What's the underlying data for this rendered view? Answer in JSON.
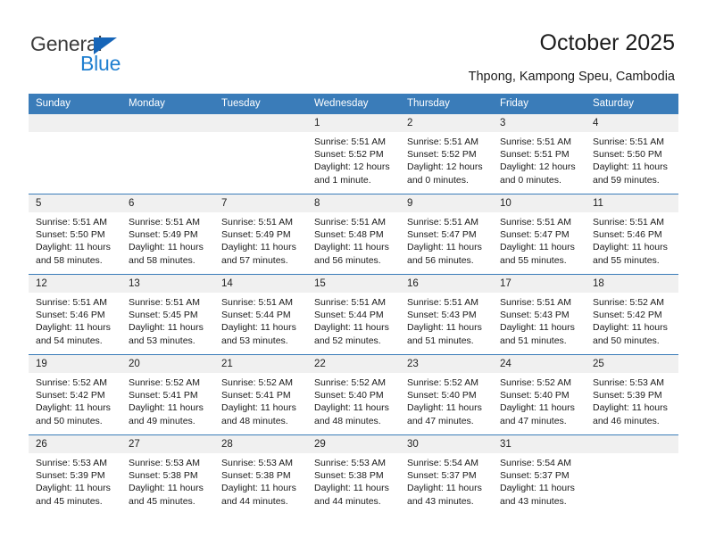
{
  "brand": {
    "name_part1": "General",
    "name_part2": "Blue",
    "accent_color": "#1f7fd0",
    "triangle_color": "#1665b8"
  },
  "header": {
    "title": "October 2025",
    "subtitle": "Thpong, Kampong Speu, Cambodia"
  },
  "calendar": {
    "header_color": "#3a7cb9",
    "weekdays": [
      "Sunday",
      "Monday",
      "Tuesday",
      "Wednesday",
      "Thursday",
      "Friday",
      "Saturday"
    ],
    "weeks": [
      [
        {
          "day": "",
          "blank": true,
          "sunrise": "",
          "sunset": "",
          "daylight1": "",
          "daylight2": ""
        },
        {
          "day": "",
          "blank": true,
          "sunrise": "",
          "sunset": "",
          "daylight1": "",
          "daylight2": ""
        },
        {
          "day": "",
          "blank": true,
          "sunrise": "",
          "sunset": "",
          "daylight1": "",
          "daylight2": ""
        },
        {
          "day": "1",
          "blank": false,
          "sunrise": "Sunrise: 5:51 AM",
          "sunset": "Sunset: 5:52 PM",
          "daylight1": "Daylight: 12 hours",
          "daylight2": "and 1 minute."
        },
        {
          "day": "2",
          "blank": false,
          "sunrise": "Sunrise: 5:51 AM",
          "sunset": "Sunset: 5:52 PM",
          "daylight1": "Daylight: 12 hours",
          "daylight2": "and 0 minutes."
        },
        {
          "day": "3",
          "blank": false,
          "sunrise": "Sunrise: 5:51 AM",
          "sunset": "Sunset: 5:51 PM",
          "daylight1": "Daylight: 12 hours",
          "daylight2": "and 0 minutes."
        },
        {
          "day": "4",
          "blank": false,
          "sunrise": "Sunrise: 5:51 AM",
          "sunset": "Sunset: 5:50 PM",
          "daylight1": "Daylight: 11 hours",
          "daylight2": "and 59 minutes."
        }
      ],
      [
        {
          "day": "5",
          "blank": false,
          "sunrise": "Sunrise: 5:51 AM",
          "sunset": "Sunset: 5:50 PM",
          "daylight1": "Daylight: 11 hours",
          "daylight2": "and 58 minutes."
        },
        {
          "day": "6",
          "blank": false,
          "sunrise": "Sunrise: 5:51 AM",
          "sunset": "Sunset: 5:49 PM",
          "daylight1": "Daylight: 11 hours",
          "daylight2": "and 58 minutes."
        },
        {
          "day": "7",
          "blank": false,
          "sunrise": "Sunrise: 5:51 AM",
          "sunset": "Sunset: 5:49 PM",
          "daylight1": "Daylight: 11 hours",
          "daylight2": "and 57 minutes."
        },
        {
          "day": "8",
          "blank": false,
          "sunrise": "Sunrise: 5:51 AM",
          "sunset": "Sunset: 5:48 PM",
          "daylight1": "Daylight: 11 hours",
          "daylight2": "and 56 minutes."
        },
        {
          "day": "9",
          "blank": false,
          "sunrise": "Sunrise: 5:51 AM",
          "sunset": "Sunset: 5:47 PM",
          "daylight1": "Daylight: 11 hours",
          "daylight2": "and 56 minutes."
        },
        {
          "day": "10",
          "blank": false,
          "sunrise": "Sunrise: 5:51 AM",
          "sunset": "Sunset: 5:47 PM",
          "daylight1": "Daylight: 11 hours",
          "daylight2": "and 55 minutes."
        },
        {
          "day": "11",
          "blank": false,
          "sunrise": "Sunrise: 5:51 AM",
          "sunset": "Sunset: 5:46 PM",
          "daylight1": "Daylight: 11 hours",
          "daylight2": "and 55 minutes."
        }
      ],
      [
        {
          "day": "12",
          "blank": false,
          "sunrise": "Sunrise: 5:51 AM",
          "sunset": "Sunset: 5:46 PM",
          "daylight1": "Daylight: 11 hours",
          "daylight2": "and 54 minutes."
        },
        {
          "day": "13",
          "blank": false,
          "sunrise": "Sunrise: 5:51 AM",
          "sunset": "Sunset: 5:45 PM",
          "daylight1": "Daylight: 11 hours",
          "daylight2": "and 53 minutes."
        },
        {
          "day": "14",
          "blank": false,
          "sunrise": "Sunrise: 5:51 AM",
          "sunset": "Sunset: 5:44 PM",
          "daylight1": "Daylight: 11 hours",
          "daylight2": "and 53 minutes."
        },
        {
          "day": "15",
          "blank": false,
          "sunrise": "Sunrise: 5:51 AM",
          "sunset": "Sunset: 5:44 PM",
          "daylight1": "Daylight: 11 hours",
          "daylight2": "and 52 minutes."
        },
        {
          "day": "16",
          "blank": false,
          "sunrise": "Sunrise: 5:51 AM",
          "sunset": "Sunset: 5:43 PM",
          "daylight1": "Daylight: 11 hours",
          "daylight2": "and 51 minutes."
        },
        {
          "day": "17",
          "blank": false,
          "sunrise": "Sunrise: 5:51 AM",
          "sunset": "Sunset: 5:43 PM",
          "daylight1": "Daylight: 11 hours",
          "daylight2": "and 51 minutes."
        },
        {
          "day": "18",
          "blank": false,
          "sunrise": "Sunrise: 5:52 AM",
          "sunset": "Sunset: 5:42 PM",
          "daylight1": "Daylight: 11 hours",
          "daylight2": "and 50 minutes."
        }
      ],
      [
        {
          "day": "19",
          "blank": false,
          "sunrise": "Sunrise: 5:52 AM",
          "sunset": "Sunset: 5:42 PM",
          "daylight1": "Daylight: 11 hours",
          "daylight2": "and 50 minutes."
        },
        {
          "day": "20",
          "blank": false,
          "sunrise": "Sunrise: 5:52 AM",
          "sunset": "Sunset: 5:41 PM",
          "daylight1": "Daylight: 11 hours",
          "daylight2": "and 49 minutes."
        },
        {
          "day": "21",
          "blank": false,
          "sunrise": "Sunrise: 5:52 AM",
          "sunset": "Sunset: 5:41 PM",
          "daylight1": "Daylight: 11 hours",
          "daylight2": "and 48 minutes."
        },
        {
          "day": "22",
          "blank": false,
          "sunrise": "Sunrise: 5:52 AM",
          "sunset": "Sunset: 5:40 PM",
          "daylight1": "Daylight: 11 hours",
          "daylight2": "and 48 minutes."
        },
        {
          "day": "23",
          "blank": false,
          "sunrise": "Sunrise: 5:52 AM",
          "sunset": "Sunset: 5:40 PM",
          "daylight1": "Daylight: 11 hours",
          "daylight2": "and 47 minutes."
        },
        {
          "day": "24",
          "blank": false,
          "sunrise": "Sunrise: 5:52 AM",
          "sunset": "Sunset: 5:40 PM",
          "daylight1": "Daylight: 11 hours",
          "daylight2": "and 47 minutes."
        },
        {
          "day": "25",
          "blank": false,
          "sunrise": "Sunrise: 5:53 AM",
          "sunset": "Sunset: 5:39 PM",
          "daylight1": "Daylight: 11 hours",
          "daylight2": "and 46 minutes."
        }
      ],
      [
        {
          "day": "26",
          "blank": false,
          "sunrise": "Sunrise: 5:53 AM",
          "sunset": "Sunset: 5:39 PM",
          "daylight1": "Daylight: 11 hours",
          "daylight2": "and 45 minutes."
        },
        {
          "day": "27",
          "blank": false,
          "sunrise": "Sunrise: 5:53 AM",
          "sunset": "Sunset: 5:38 PM",
          "daylight1": "Daylight: 11 hours",
          "daylight2": "and 45 minutes."
        },
        {
          "day": "28",
          "blank": false,
          "sunrise": "Sunrise: 5:53 AM",
          "sunset": "Sunset: 5:38 PM",
          "daylight1": "Daylight: 11 hours",
          "daylight2": "and 44 minutes."
        },
        {
          "day": "29",
          "blank": false,
          "sunrise": "Sunrise: 5:53 AM",
          "sunset": "Sunset: 5:38 PM",
          "daylight1": "Daylight: 11 hours",
          "daylight2": "and 44 minutes."
        },
        {
          "day": "30",
          "blank": false,
          "sunrise": "Sunrise: 5:54 AM",
          "sunset": "Sunset: 5:37 PM",
          "daylight1": "Daylight: 11 hours",
          "daylight2": "and 43 minutes."
        },
        {
          "day": "31",
          "blank": false,
          "sunrise": "Sunrise: 5:54 AM",
          "sunset": "Sunset: 5:37 PM",
          "daylight1": "Daylight: 11 hours",
          "daylight2": "and 43 minutes."
        },
        {
          "day": "",
          "blank": true,
          "sunrise": "",
          "sunset": "",
          "daylight1": "",
          "daylight2": ""
        }
      ]
    ]
  }
}
